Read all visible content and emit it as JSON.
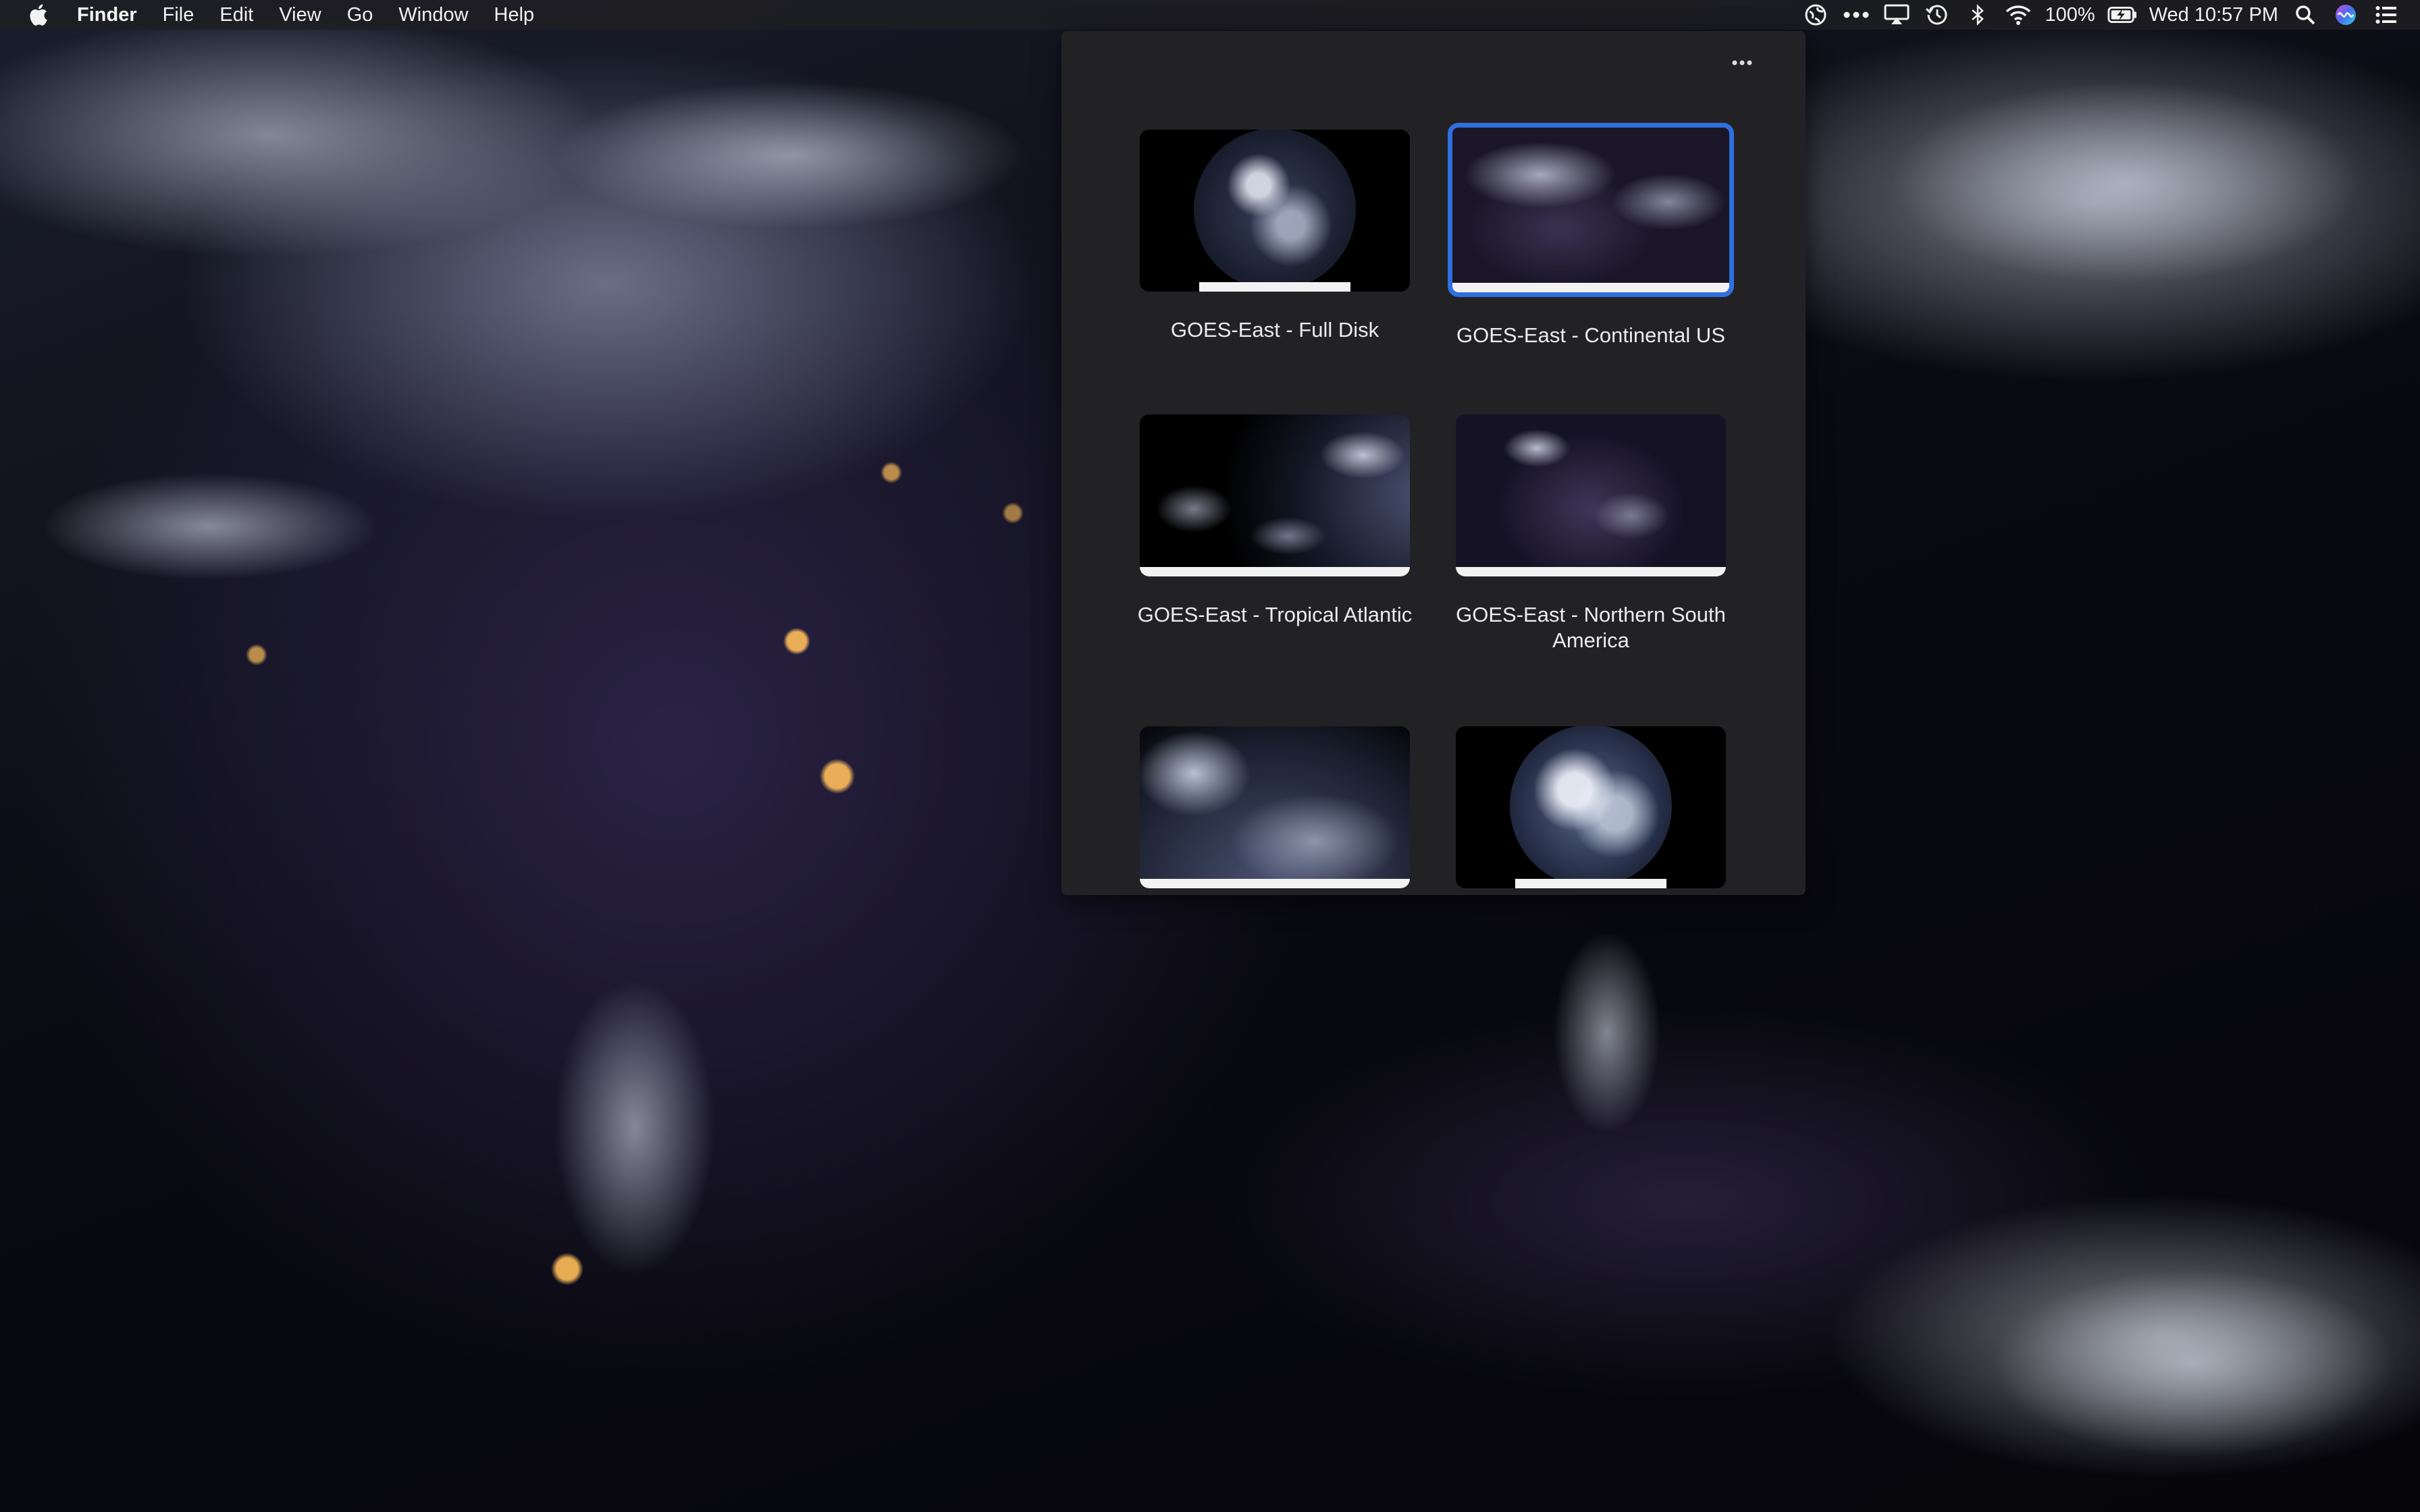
{
  "menubar": {
    "app_name": "Finder",
    "menus": [
      "File",
      "Edit",
      "View",
      "Go",
      "Window",
      "Help"
    ],
    "battery": "100%",
    "clock": "Wed 10:57 PM"
  },
  "popover": {
    "tiles": [
      {
        "label": "GOES-East - Full Disk",
        "selected": false
      },
      {
        "label": "GOES-East - Continental US",
        "selected": true
      },
      {
        "label": "GOES-East - Tropical Atlantic",
        "selected": false
      },
      {
        "label": "GOES-East - Northern South America",
        "selected": false
      },
      {
        "label": "",
        "selected": false
      },
      {
        "label": "",
        "selected": false
      }
    ]
  },
  "colors": {
    "selection_border": "#2f6fe0",
    "popover_bg": "#222224",
    "menubar_bg": "#1e1e22"
  },
  "icons": [
    "apple-icon",
    "globe-status-icon",
    "more-status-icon",
    "airplay-icon",
    "time-machine-icon",
    "bluetooth-icon",
    "wifi-icon",
    "battery-icon",
    "search-icon",
    "siri-icon",
    "notification-center-icon",
    "more-options-icon"
  ]
}
